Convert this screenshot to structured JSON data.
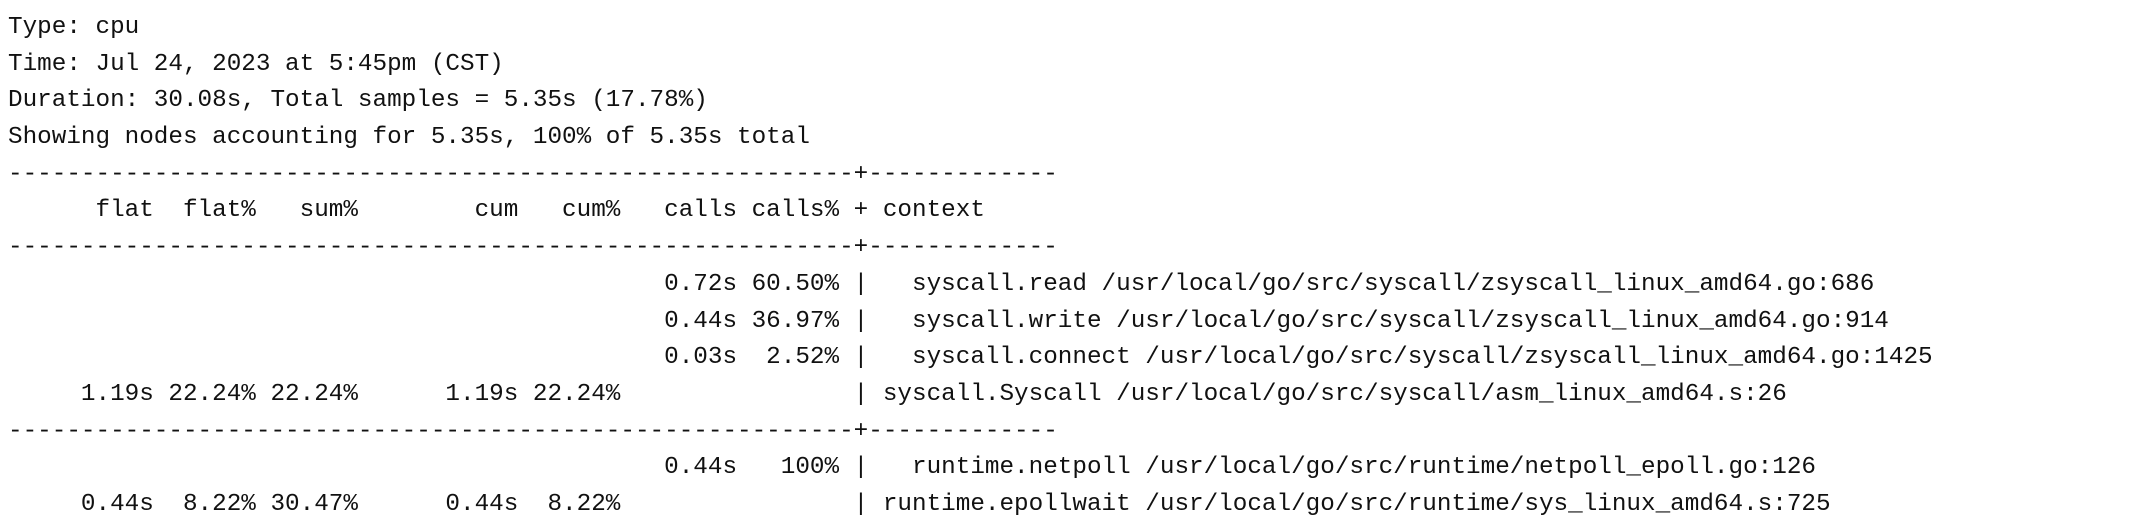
{
  "header": {
    "type_line": "Type: cpu",
    "time_line": "Time: Jul 24, 2023 at 5:45pm (CST)",
    "duration_line": "Duration: 30.08s, Total samples = 5.35s (17.78%)",
    "showing_line": "Showing nodes accounting for 5.35s, 100% of 5.35s total"
  },
  "table": {
    "separator": "----------------------------------------------------------+-------------",
    "column_header": "      flat  flat%   sum%        cum   cum%   calls calls% + context",
    "rows": [
      "                                             0.72s 60.50% |   syscall.read /usr/local/go/src/syscall/zsyscall_linux_amd64.go:686",
      "                                             0.44s 36.97% |   syscall.write /usr/local/go/src/syscall/zsyscall_linux_amd64.go:914",
      "                                             0.03s  2.52% |   syscall.connect /usr/local/go/src/syscall/zsyscall_linux_amd64.go:1425",
      "     1.19s 22.24% 22.24%      1.19s 22.24%                | syscall.Syscall /usr/local/go/src/syscall/asm_linux_amd64.s:26",
      "                                             0.44s   100% |   runtime.netpoll /usr/local/go/src/runtime/netpoll_epoll.go:126",
      "     0.44s  8.22% 30.47%      0.44s  8.22%                | runtime.epollwait /usr/local/go/src/runtime/sys_linux_amd64.s:725"
    ]
  }
}
